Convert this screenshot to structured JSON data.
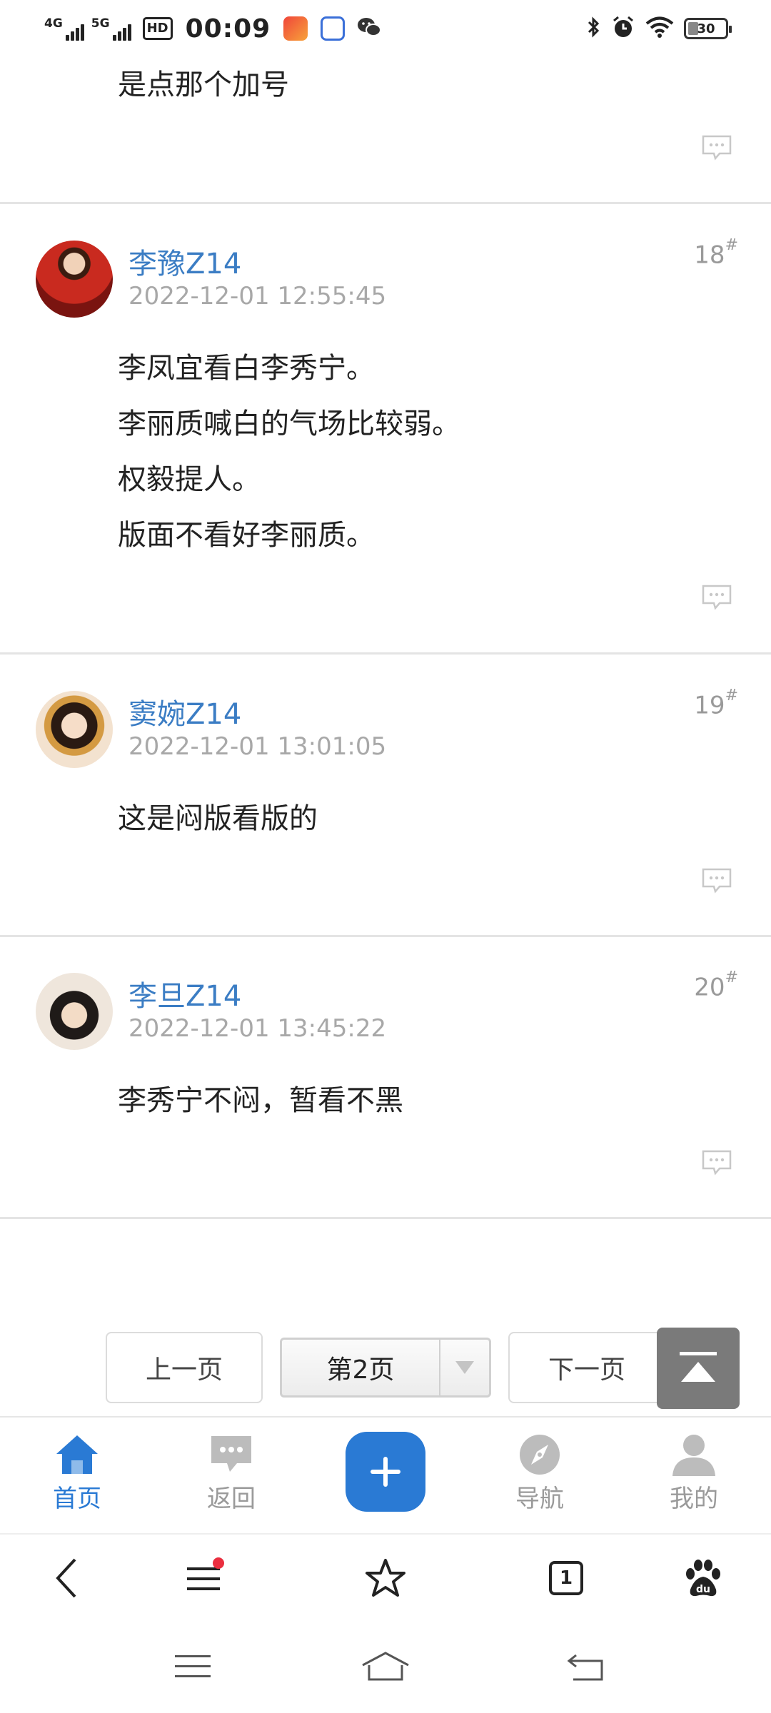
{
  "status_bar": {
    "network1": "4G",
    "network2": "5G",
    "hd_label": "HD",
    "time": "00:09",
    "battery": "30",
    "battery_level": 0.3
  },
  "top_post_text": "是点那个加号",
  "posts": [
    {
      "username": "李豫Z14",
      "time": "2022-12-01 12:55:45",
      "floor": "18",
      "lines": [
        "李凤宜看白李秀宁。",
        "李丽质喊白的气场比较弱。",
        "权毅提人。",
        "版面不看好李丽质。"
      ]
    },
    {
      "username": "窦婉Z14",
      "time": "2022-12-01 13:01:05",
      "floor": "19",
      "lines": [
        "这是闷版看版的"
      ]
    },
    {
      "username": "李旦Z14",
      "time": "2022-12-01 13:45:22",
      "floor": "20",
      "lines": [
        "李秀宁不闷，暂看不黑"
      ]
    }
  ],
  "floor_mark": "#",
  "pager": {
    "prev": "上一页",
    "current": "第2页",
    "next": "下一页"
  },
  "tabbar": {
    "home": "首页",
    "back": "返回",
    "nav": "导航",
    "mine": "我的"
  },
  "browser": {
    "tab_count": "1"
  },
  "colors": {
    "accent": "#2a7ad4",
    "username": "#3b7dc4",
    "notification_dot": "#ea2e3f"
  }
}
